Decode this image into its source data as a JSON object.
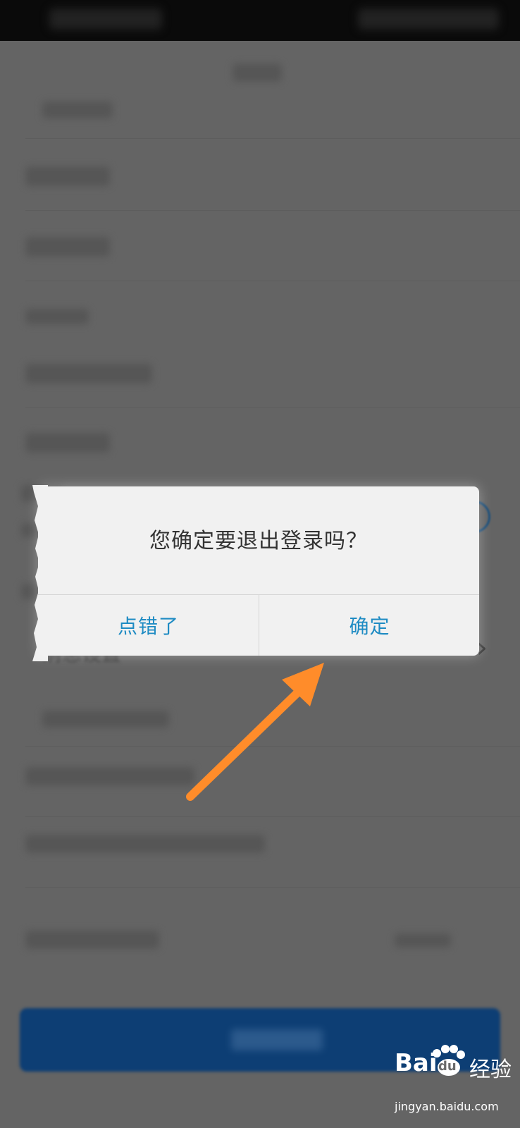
{
  "dialog": {
    "message": "您确定要退出登录吗？",
    "cancel_label": "点错了",
    "confirm_label": "确定"
  },
  "background": {
    "partial_item_text": "消息设置"
  },
  "watermark": {
    "brand_latin": "Bai",
    "brand_du": "du",
    "brand_cn": "经验",
    "domain": "jingyan.baidu.com"
  },
  "colors": {
    "overlay": "#6a6a6a",
    "dialog_bg": "#f1f1f1",
    "dialog_text": "#333333",
    "button_text": "#1e8bc3",
    "arrow": "#ff8c2a",
    "logout_button": "#0d3e74"
  },
  "icons": {
    "chevron": "chevron-right-icon",
    "arrow": "orange-annotation-arrow"
  }
}
